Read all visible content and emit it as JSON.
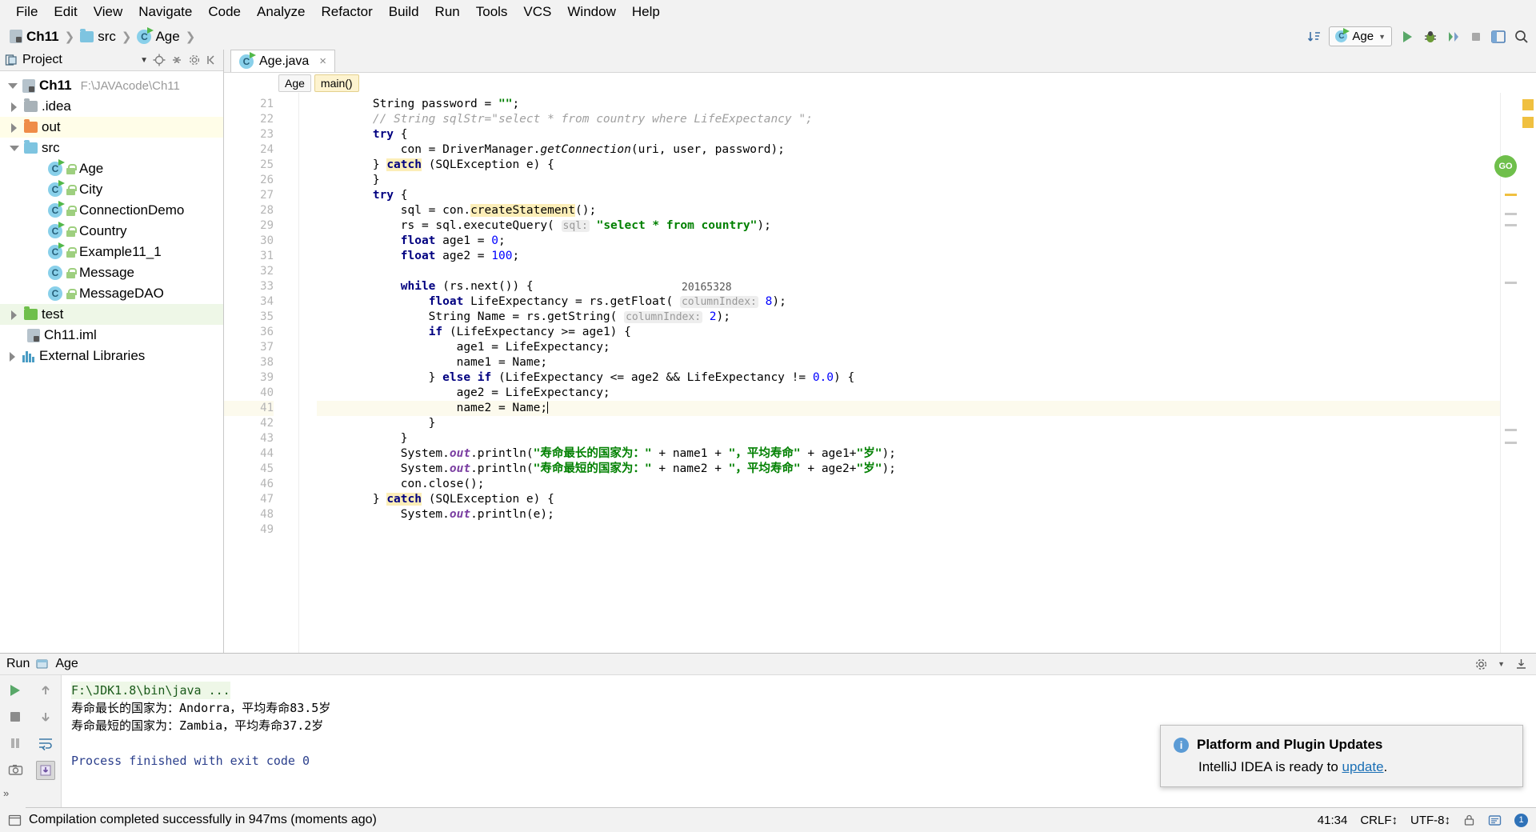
{
  "menu": {
    "items": [
      "File",
      "Edit",
      "View",
      "Navigate",
      "Code",
      "Analyze",
      "Refactor",
      "Build",
      "Run",
      "Tools",
      "VCS",
      "Window",
      "Help"
    ]
  },
  "navbar": {
    "breadcrumbs": [
      {
        "label": "Ch11",
        "icon": "module-icon"
      },
      {
        "label": "src",
        "icon": "folder-icon"
      },
      {
        "label": "Age",
        "icon": "java-class-icon"
      }
    ],
    "run_config": "Age",
    "icons": [
      "sort-icon",
      "run-icon",
      "debug-icon",
      "coverage-icon",
      "stop-icon",
      "layout-icon",
      "search-icon"
    ]
  },
  "project_panel": {
    "title": "Project",
    "header_icons": [
      "collapse-icon",
      "locate-icon",
      "collapse-all-icon",
      "settings-icon",
      "hide-icon"
    ],
    "tree": [
      {
        "label": "Ch11",
        "detail": "F:\\JAVAcode\\Ch11",
        "icon": "module-icon",
        "arrow": "down",
        "indent": 0,
        "bold": true,
        "highlight": "none"
      },
      {
        "label": ".idea",
        "detail": "",
        "icon": "folder-gray",
        "arrow": "right",
        "indent": 1,
        "bold": false,
        "highlight": "none"
      },
      {
        "label": "out",
        "detail": "",
        "icon": "folder-orange",
        "arrow": "right",
        "indent": 1,
        "bold": false,
        "highlight": "yellow"
      },
      {
        "label": "src",
        "detail": "",
        "icon": "folder-blue",
        "arrow": "down",
        "indent": 1,
        "bold": false,
        "highlight": "none"
      },
      {
        "label": "Age",
        "detail": "",
        "icon": "class-runnable",
        "arrow": "none",
        "indent": 2,
        "bold": false,
        "highlight": "none"
      },
      {
        "label": "City",
        "detail": "",
        "icon": "class-runnable",
        "arrow": "none",
        "indent": 2,
        "bold": false,
        "highlight": "none"
      },
      {
        "label": "ConnectionDemo",
        "detail": "",
        "icon": "class-runnable",
        "arrow": "none",
        "indent": 2,
        "bold": false,
        "highlight": "none"
      },
      {
        "label": "Country",
        "detail": "",
        "icon": "class-runnable",
        "arrow": "none",
        "indent": 2,
        "bold": false,
        "highlight": "none"
      },
      {
        "label": "Example11_1",
        "detail": "",
        "icon": "class-runnable",
        "arrow": "none",
        "indent": 2,
        "bold": false,
        "highlight": "none"
      },
      {
        "label": "Message",
        "detail": "",
        "icon": "class",
        "arrow": "none",
        "indent": 2,
        "bold": false,
        "highlight": "none"
      },
      {
        "label": "MessageDAO",
        "detail": "",
        "icon": "class",
        "arrow": "none",
        "indent": 2,
        "bold": false,
        "highlight": "none"
      },
      {
        "label": "test",
        "detail": "",
        "icon": "folder-green",
        "arrow": "right",
        "indent": 1,
        "bold": false,
        "highlight": "green"
      },
      {
        "label": "Ch11.iml",
        "detail": "",
        "icon": "module-file-icon",
        "arrow": "none",
        "indent": 2,
        "bold": false,
        "highlight": "none"
      },
      {
        "label": "External Libraries",
        "detail": "",
        "icon": "library-icon",
        "arrow": "right",
        "indent": 0,
        "bold": false,
        "highlight": "none"
      }
    ]
  },
  "editor": {
    "tab": {
      "label": "Age.java",
      "icon": "java-class-icon",
      "close": "×"
    },
    "breadcrumbs": [
      {
        "label": "Age",
        "selected": false
      },
      {
        "label": "main()",
        "selected": true
      }
    ],
    "watermark": "20165328",
    "first_line_number": 21,
    "current_line": 41,
    "lines": [
      {
        "n": 21,
        "html": "        String password = <span class=\"str\">\"\"</span>;"
      },
      {
        "n": 22,
        "html": "        <span class=\"cmt\">// String sqlStr=\"select * from country where LifeExpectancy \";</span>"
      },
      {
        "n": 23,
        "html": "        <span class=\"kw\">try</span> {"
      },
      {
        "n": 24,
        "html": "            con = DriverManager.<span class=\"meth\">getConnection</span>(uri, user, password);"
      },
      {
        "n": 25,
        "html": "        } <span class=\"kw hl\">catch</span> (SQLException e) {"
      },
      {
        "n": 26,
        "html": "        }"
      },
      {
        "n": 27,
        "html": "        <span class=\"kw\">try</span> {"
      },
      {
        "n": 28,
        "html": "            sql = con.<span class=\"hl\">createStatement</span>();"
      },
      {
        "n": 29,
        "html": "            rs = sql.executeQuery( <span class=\"hint\">sql:</span> <span class=\"str\">\"select * from country\"</span>);"
      },
      {
        "n": 30,
        "html": "            <span class=\"kw\">float</span> age1 = <span class=\"num\">0</span>;"
      },
      {
        "n": 31,
        "html": "            <span class=\"kw\">float</span> age2 = <span class=\"num\">100</span>;"
      },
      {
        "n": 32,
        "html": ""
      },
      {
        "n": 33,
        "html": "            <span class=\"kw\">while</span> (rs.next()) {"
      },
      {
        "n": 34,
        "html": "                <span class=\"kw\">float</span> LifeExpectancy = rs.getFloat( <span class=\"hint\">columnIndex:</span> <span class=\"num\">8</span>);"
      },
      {
        "n": 35,
        "html": "                String Name = rs.getString( <span class=\"hint\">columnIndex:</span> <span class=\"num\">2</span>);"
      },
      {
        "n": 36,
        "html": "                <span class=\"kw\">if</span> (LifeExpectancy &gt;= age1) {"
      },
      {
        "n": 37,
        "html": "                    age1 = LifeExpectancy;"
      },
      {
        "n": 38,
        "html": "                    name1 = Name;"
      },
      {
        "n": 39,
        "html": "                } <span class=\"kw\">else if</span> (LifeExpectancy &lt;= age2 &amp;&amp; LifeExpectancy != <span class=\"num\">0.0</span>) {"
      },
      {
        "n": 40,
        "html": "                    age2 = LifeExpectancy;"
      },
      {
        "n": 41,
        "html": "                    name2 = Name;<span class=\"caret\"></span>"
      },
      {
        "n": 42,
        "html": "                }"
      },
      {
        "n": 43,
        "html": "            }"
      },
      {
        "n": 44,
        "html": "            System.<span class=\"stat\">out</span>.println(<span class=\"str\">\"寿命最长的国家为：\"</span> + name1 + <span class=\"str\">\"，平均寿命\"</span> + age1+<span class=\"str\">\"岁\"</span>);"
      },
      {
        "n": 45,
        "html": "            System.<span class=\"stat\">out</span>.println(<span class=\"str\">\"寿命最短的国家为：\"</span> + name2 + <span class=\"str\">\"，平均寿命\"</span> + age2+<span class=\"str\">\"岁\"</span>);"
      },
      {
        "n": 46,
        "html": "            con.close();"
      },
      {
        "n": 47,
        "html": "        } <span class=\"kw hl\">catch</span> (SQLException e) {"
      },
      {
        "n": 48,
        "html": "            System.<span class=\"stat\">out</span>.println(e);"
      },
      {
        "n": 49,
        "html": ""
      }
    ]
  },
  "run_window": {
    "title": "Run",
    "config_label": "Age",
    "left_icons": [
      "run-icon",
      "stop-icon",
      "pause-icon",
      "camera-icon"
    ],
    "left_icons2": [
      "up-arrow-icon",
      "down-arrow-icon",
      "soft-wrap-icon",
      "scroll-to-end-icon"
    ],
    "right_icons": [
      "settings-icon",
      "export-icon"
    ],
    "console": [
      {
        "text": "F:\\JDK1.8\\bin\\java ...",
        "style": "command"
      },
      {
        "text": "寿命最长的国家为：Andorra，平均寿命83.5岁",
        "style": "normal"
      },
      {
        "text": "寿命最短的国家为：Zambia，平均寿命37.2岁",
        "style": "normal"
      },
      {
        "text": "",
        "style": "normal"
      },
      {
        "text": "Process finished with exit code 0",
        "style": "info"
      }
    ]
  },
  "notification": {
    "icon": "info-icon",
    "title": "Platform and Plugin Updates",
    "body_prefix": "IntelliJ IDEA is ready to ",
    "link": "update",
    "body_suffix": "."
  },
  "statusbar": {
    "message": "Compilation completed successfully in 947ms (moments ago)",
    "caret_position": "41:34",
    "line_separator": "CRLF↕",
    "encoding": "UTF-8↕",
    "lock_icon": "lock-icon",
    "event_log_count": "1"
  },
  "colors": {
    "accent_green": "#6fbf4b",
    "string_green": "#008000",
    "keyword_blue": "#000080",
    "highlight_yellow": "#fceeb8",
    "link_blue": "#1a6fb5"
  }
}
